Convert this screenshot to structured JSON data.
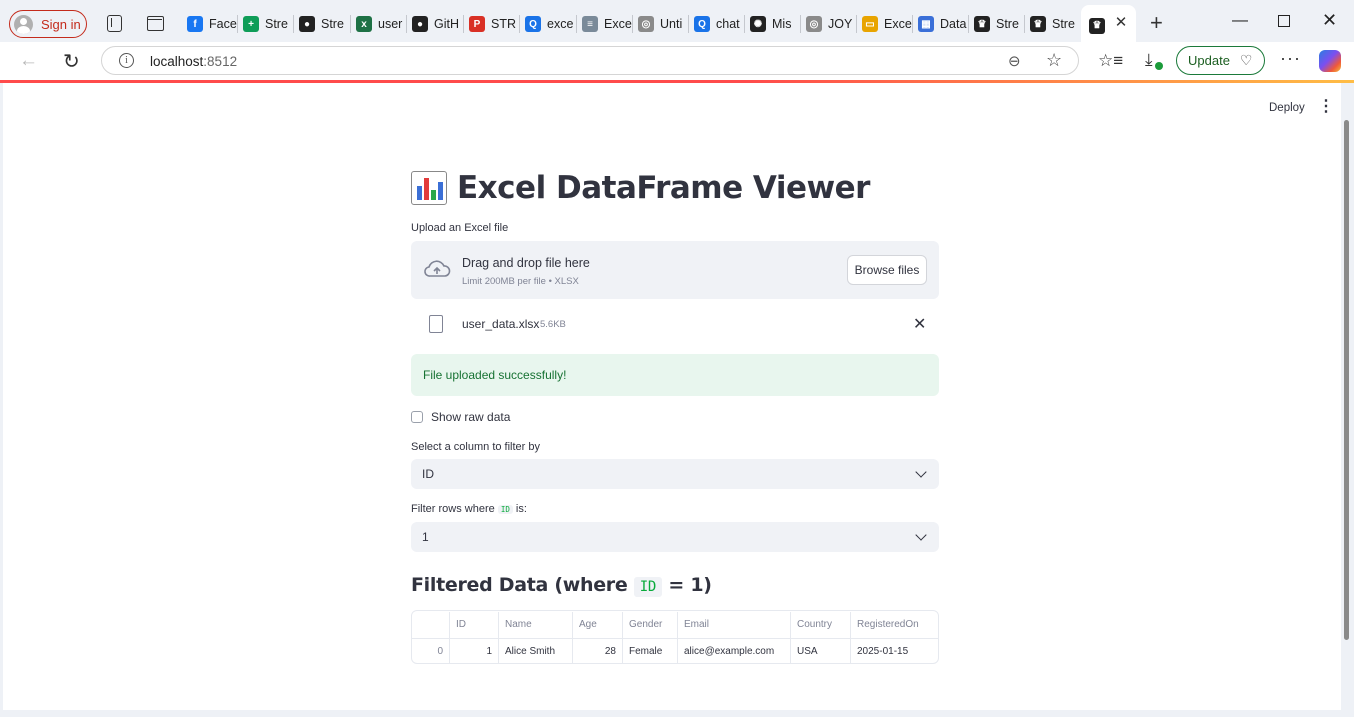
{
  "browser": {
    "sign_in_label": "Sign in",
    "tabs": [
      {
        "icon": "facebook-icon",
        "title": "Face",
        "color": "#1877f2",
        "glyph": "f"
      },
      {
        "icon": "sheets-icon",
        "title": "Stre",
        "color": "#0f9d58",
        "glyph": "+"
      },
      {
        "icon": "github-icon",
        "title": "Stre",
        "color": "#222222",
        "glyph": "●"
      },
      {
        "icon": "excel-icon",
        "title": "user",
        "color": "#1e7145",
        "glyph": "x"
      },
      {
        "icon": "github-icon",
        "title": "GitH",
        "color": "#222222",
        "glyph": "●"
      },
      {
        "icon": "pdf-icon",
        "title": "STR",
        "color": "#d93025",
        "glyph": "P"
      },
      {
        "icon": "search-icon",
        "title": "exce",
        "color": "#1a73e8",
        "glyph": "Q"
      },
      {
        "icon": "excel-doc-icon",
        "title": "Exce",
        "color": "#7a8a99",
        "glyph": "≡"
      },
      {
        "icon": "globe-icon",
        "title": "Unti",
        "color": "#8a8a8a",
        "glyph": "◎"
      },
      {
        "icon": "search-icon",
        "title": "chat",
        "color": "#1a73e8",
        "glyph": "Q"
      },
      {
        "icon": "openai-icon",
        "title": "Mis",
        "color": "#222222",
        "glyph": "✺"
      },
      {
        "icon": "globe-icon",
        "title": "JOY",
        "color": "#8a8a8a",
        "glyph": "◎"
      },
      {
        "icon": "folder-icon",
        "title": "Exce",
        "color": "#e8a400",
        "glyph": "▭"
      },
      {
        "icon": "data-icon",
        "title": "Data",
        "color": "#3a6fd8",
        "glyph": "▦"
      },
      {
        "icon": "streamlit-icon",
        "title": "Stre",
        "color": "#222222",
        "glyph": "♛"
      },
      {
        "icon": "streamlit-icon",
        "title": "Stre",
        "color": "#222222",
        "glyph": "♛"
      }
    ],
    "active_tab": {
      "icon": "streamlit-icon",
      "glyph": "♛"
    },
    "url_host": "localhost",
    "url_port": ":8512",
    "update_label": "Update"
  },
  "app": {
    "deploy_label": "Deploy",
    "title": "Excel DataFrame Viewer",
    "upload_label": "Upload an Excel file",
    "dropzone_text": "Drag and drop file here",
    "dropzone_limit": "Limit 200MB per file • XLSX",
    "browse_label": "Browse files",
    "file_name": "user_data.xlsx",
    "file_size": "5.6KB",
    "success_message": "File uploaded successfully!",
    "show_raw_label": "Show raw data",
    "select_column_label": "Select a column to filter by",
    "selected_column": "ID",
    "filter_label_prefix": "Filter rows where",
    "filter_label_col": "ID",
    "filter_label_suffix": "is:",
    "selected_value": "1",
    "filtered_title_prefix": "Filtered Data (where",
    "filtered_title_col": "ID",
    "filtered_title_suffix": "= 1)"
  },
  "table": {
    "columns": [
      "",
      "ID",
      "Name",
      "Age",
      "Gender",
      "Email",
      "Country",
      "RegisteredOn"
    ],
    "rows": [
      [
        "0",
        "1",
        "Alice Smith",
        "28",
        "Female",
        "alice@example.com",
        "USA",
        "2025-01-15"
      ]
    ]
  }
}
